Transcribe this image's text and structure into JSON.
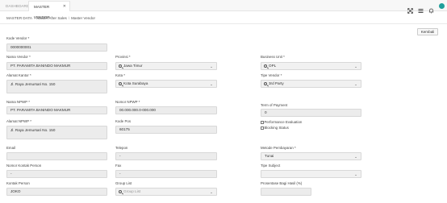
{
  "tabs": [
    {
      "label": "DASHBOARD",
      "active": false
    },
    {
      "label": "MASTER VENDOR",
      "active": true
    }
  ],
  "breadcrumb": [
    "MASTER DATA",
    "Master After Sales",
    "Master Vendor"
  ],
  "breadcrumb_sep": "\\",
  "back_label": "Kembali",
  "fields": {
    "kode_vendor": {
      "label": "Kode Vendor *",
      "value": "0000000001"
    },
    "nama_vendor": {
      "label": "Nama Vendor *",
      "value": "PT. PARAMITA BANINDO MAKMUR"
    },
    "provinsi": {
      "label": "Provinsi *",
      "value": "Jawa Timur"
    },
    "business_unit": {
      "label": "Business Unit *",
      "value": "OPL"
    },
    "alamat_kantor": {
      "label": "Alamat Kantor *",
      "value": "Jl. Raya Jemursari  No. 150"
    },
    "kota": {
      "label": "Kota *",
      "value": "Kota Surabaya"
    },
    "tipe_vendor": {
      "label": "Tipe Vendor *",
      "value": "3rd Party"
    },
    "nama_npwp": {
      "label": "Nama NPWP *",
      "value": "PT. PARAMITA BANINDO MAKMUR"
    },
    "nomor_npwp": {
      "label": "Nomor NPWP *",
      "value": "00.000.000.0-000.000"
    },
    "term_of_payment": {
      "label": "Term of Payment",
      "value": "0"
    },
    "alamat_npwp": {
      "label": "Alamat NPWP *",
      "value": "Jl. Raya Jemursari  No. 150"
    },
    "kode_pos": {
      "label": "Kode Pos",
      "value": "60175"
    },
    "email": {
      "label": "Email",
      "value": ""
    },
    "telepon": {
      "label": "Telepon",
      "value": "-"
    },
    "metode_pembayaran": {
      "label": "Metode Pembayaran *",
      "value": "Tunai"
    },
    "nomor_kontak_person": {
      "label": "Nomor Kontak Person",
      "value": "-"
    },
    "fax": {
      "label": "Fax",
      "value": "-"
    },
    "tipe_subject": {
      "label": "Tipe Subject",
      "value": ""
    },
    "kontak_person": {
      "label": "Kontak Person",
      "value": "JOKO"
    },
    "group_list": {
      "label": "Group List",
      "placeholder": "Group List"
    },
    "prosentase": {
      "label": "Prosentase Bagi Hasil (%)",
      "value": ""
    }
  },
  "checkboxes": {
    "performance_evaluation": {
      "label": "Performance Evaluation",
      "checked": false
    },
    "blocking_status": {
      "label": "Blocking Status",
      "checked": false
    }
  },
  "icons": {
    "expand": "expand-icon",
    "menu": "menu-icon",
    "notification": "bell-icon",
    "user": "avatar"
  },
  "colors": {
    "avatar": "#1f9e9a"
  }
}
